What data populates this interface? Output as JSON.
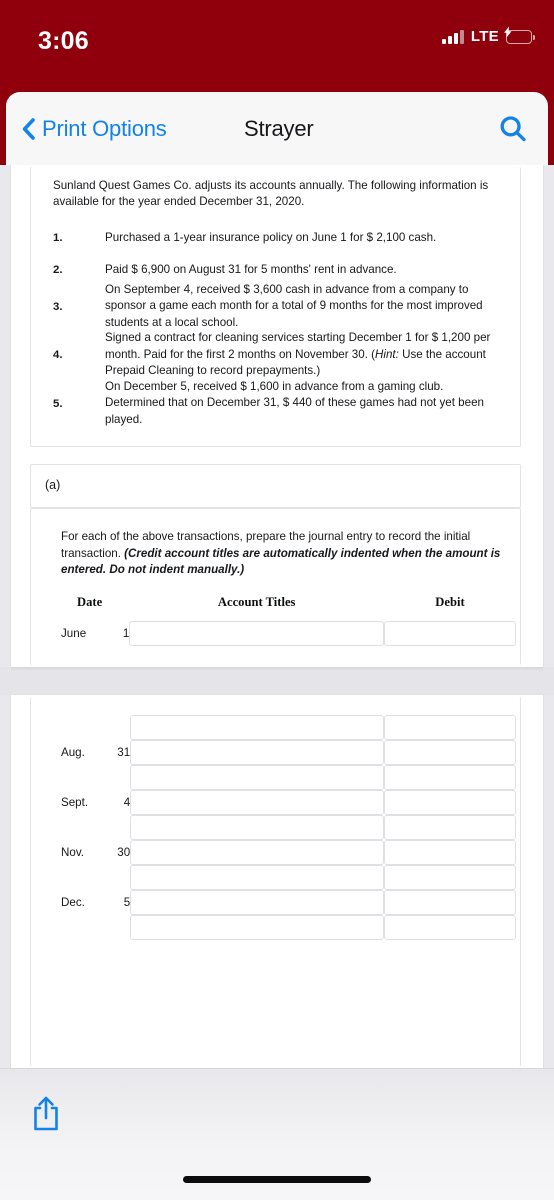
{
  "status_bar": {
    "time": "3:06",
    "network_label": "LTE",
    "signal_icon": "signal-bars-icon",
    "battery_icon": "battery-charging-icon",
    "battery_color": "#34c759",
    "background_color": "#8f000c"
  },
  "nav_bar": {
    "back_label": "Print Options",
    "back_icon": "chevron-left-icon",
    "title": "Strayer",
    "search_icon": "search-icon",
    "accent_color": "#1383e8"
  },
  "document": {
    "problem": {
      "intro": "Sunland Quest Games Co. adjusts its accounts annually. The following information is available for the year ended December 31, 2020.",
      "items": [
        {
          "num": "1.",
          "text": "Purchased a 1-year insurance policy on June 1 for $ 2,100 cash."
        },
        {
          "num": "2.",
          "text": "Paid $ 6,900 on August 31 for 5 months' rent in advance."
        },
        {
          "num": "3.",
          "text": "On September 4, received $ 3,600 cash in advance from a company to sponsor a game each month for a total of 9 months for the most improved students at a local school."
        },
        {
          "num": "4.",
          "text_before_hint": "Signed a contract for cleaning services starting December 1 for $ 1,200 per month. Paid for the first 2 months on November 30. (",
          "hint_label": "Hint:",
          "text_after_hint": " Use the account Prepaid Cleaning to record prepayments.)"
        },
        {
          "num": "5.",
          "text": "On December 5, received $ 1,600 in advance from a gaming club. Determined that on December 31, $ 440 of these games had not yet been played."
        }
      ]
    },
    "part_a": {
      "label": "(a)",
      "instruction_normal": "For each of the above transactions, prepare the journal entry to record the initial transaction. ",
      "instruction_bold_italic": "(Credit account titles are automatically indented when the amount is entered. Do not indent manually.)"
    },
    "journal": {
      "headers": {
        "date": "Date",
        "account_titles": "Account Titles",
        "debit": "Debit"
      },
      "rows_page1": [
        {
          "month": "June",
          "day": "1",
          "account_value": "",
          "debit_value": ""
        }
      ],
      "rows_page2": [
        {
          "month": "",
          "day": "",
          "account_value": "",
          "debit_value": ""
        },
        {
          "month": "Aug.",
          "day": "31",
          "account_value": "",
          "debit_value": ""
        },
        {
          "month": "",
          "day": "",
          "account_value": "",
          "debit_value": ""
        },
        {
          "month": "Sept.",
          "day": "4",
          "account_value": "",
          "debit_value": ""
        },
        {
          "month": "",
          "day": "",
          "account_value": "",
          "debit_value": ""
        },
        {
          "month": "Nov.",
          "day": "30",
          "account_value": "",
          "debit_value": ""
        },
        {
          "month": "",
          "day": "",
          "account_value": "",
          "debit_value": ""
        },
        {
          "month": "Dec.",
          "day": "5",
          "account_value": "",
          "debit_value": ""
        },
        {
          "month": "",
          "day": "",
          "account_value": "",
          "debit_value": ""
        }
      ]
    }
  },
  "toolbar": {
    "share_icon": "share-icon",
    "accent_color": "#1383e8"
  }
}
